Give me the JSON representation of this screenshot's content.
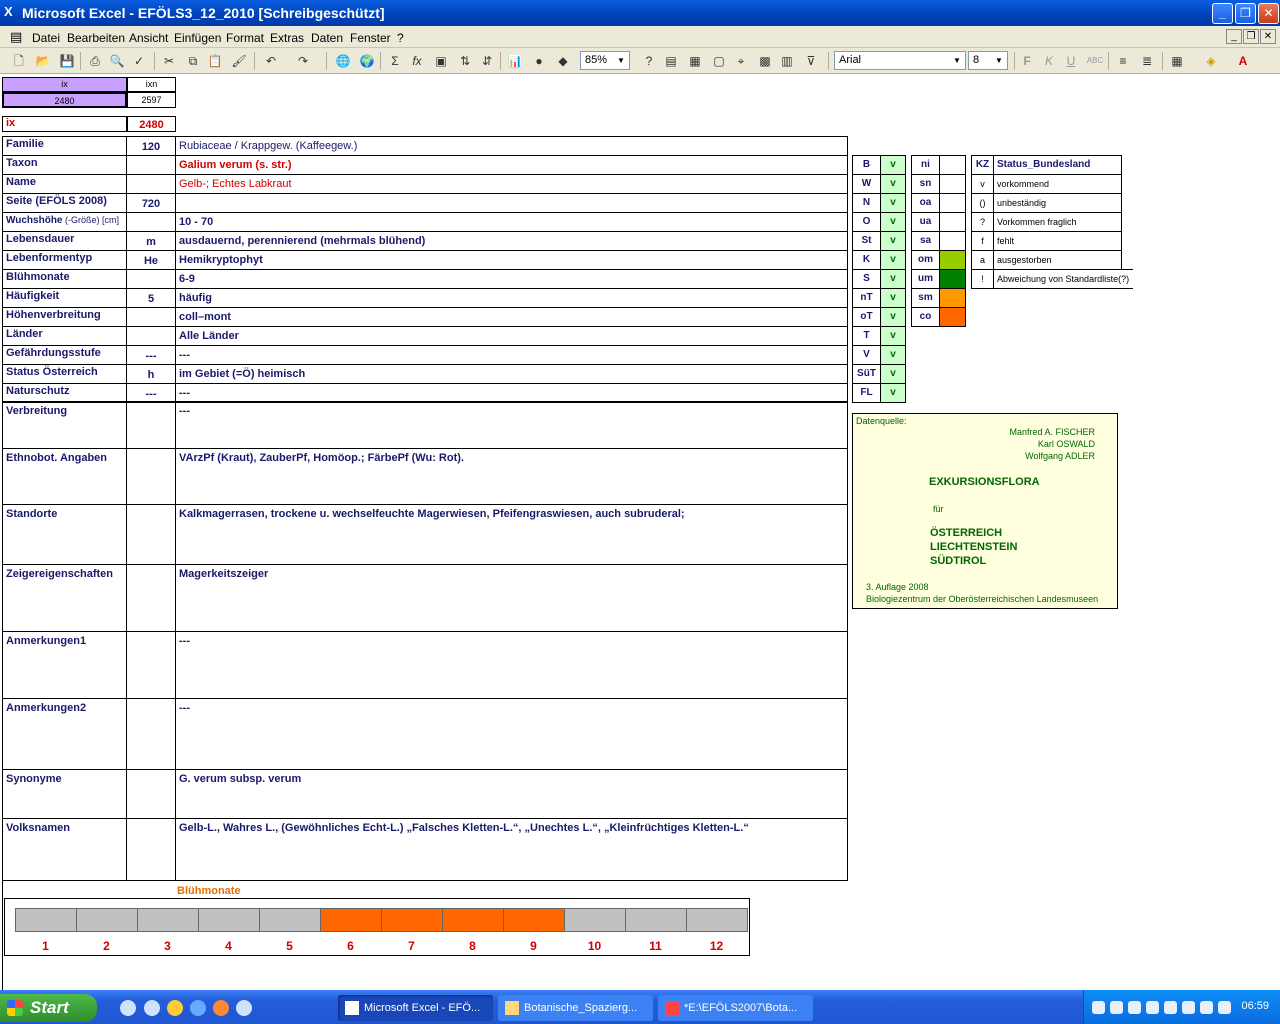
{
  "window": {
    "title": "Microsoft Excel - EFÖLS3_12_2010  [Schreibgeschützt]"
  },
  "menu": [
    "Datei",
    "Bearbeiten",
    "Ansicht",
    "Einfügen",
    "Format",
    "Extras",
    "Daten",
    "Fenster",
    "?"
  ],
  "toolbar": {
    "zoom": "85%",
    "font": "Arial",
    "size": "8"
  },
  "index": {
    "h1": "ix",
    "h2": "ixn",
    "v1": "2480",
    "v2": "2597",
    "ix_label": "ix",
    "ix_value": "2480"
  },
  "rows": [
    {
      "label": "Familie",
      "code": "120",
      "value": "Rubiaceae  /  Krappgew. (Kaffeegew.)"
    },
    {
      "label": "Taxon",
      "code": "",
      "value": "Galium verum (s. str.)"
    },
    {
      "label": "Name",
      "code": "",
      "value": "Gelb-; Echtes Labkraut"
    },
    {
      "label": "Seite (EFÖLS 2008)",
      "code": "720",
      "value": ""
    },
    {
      "label": "Wuchshöhe",
      "label_extra": " (-Größe) [cm]",
      "code": "",
      "value": " 10 - 70"
    },
    {
      "label": "Lebensdauer",
      "code": "m",
      "value": "ausdauernd, perennierend (mehrmals blühend)"
    },
    {
      "label": "Lebenformentyp",
      "code": "He",
      "value": "Hemikryptophyt"
    },
    {
      "label": "Blühmonate",
      "code": "",
      "value": " 6-9"
    },
    {
      "label": "Häufigkeit",
      "code": "5",
      "value": "häufig"
    },
    {
      "label": "Höhenverbreitung",
      "code": "",
      "value": "coll–mont"
    },
    {
      "label": "Länder",
      "code": "",
      "value": "Alle Länder"
    },
    {
      "label": "Gefährdungsstufe",
      "code": "---",
      "value": "  ---"
    },
    {
      "label": "Status Österreich",
      "code": "h",
      "value": "im Gebiet (=Ö) heimisch"
    },
    {
      "label": "Naturschutz",
      "code": "---",
      "value": " ---"
    }
  ],
  "big_rows": [
    {
      "label": "Verbreitung",
      "value": " ---"
    },
    {
      "label": "Ethnobot. Angaben",
      "value": "VArzPf (Kraut), ZauberPf, Homöop.; FärbePf (Wu: Rot)."
    },
    {
      "label": "Standorte",
      "value": "Kalkmagerrasen, trockene u. wechselfeuchte Magerwiesen, Pfeifengraswiesen, auch subruderal;"
    },
    {
      "label": "Zeigereigenschaften",
      "value": "Magerkeitszeiger"
    },
    {
      "label": "Anmerkungen1",
      "value": "---"
    },
    {
      "label": "Anmerkungen2",
      "value": "---"
    },
    {
      "label": "Synonyme",
      "value": "G. verum subsp. verum"
    },
    {
      "label": "Volksnamen",
      "value": "Gelb-L., Wahres L., (Gewöhnliches Echt-L.)  „Falsches Kletten-L.“, „Unechtes L.“, „Kleinfrüchtiges Kletten-L.“"
    }
  ],
  "states": [
    {
      "k": "B",
      "v": "v"
    },
    {
      "k": "W",
      "v": "v"
    },
    {
      "k": "N",
      "v": "v"
    },
    {
      "k": "O",
      "v": "v"
    },
    {
      "k": "St",
      "v": "v"
    },
    {
      "k": "K",
      "v": "v"
    },
    {
      "k": "S",
      "v": "v"
    },
    {
      "k": "nT",
      "v": "v"
    },
    {
      "k": "oT",
      "v": "v"
    },
    {
      "k": "T",
      "v": "v"
    },
    {
      "k": "V",
      "v": "v"
    },
    {
      "k": "SüT",
      "v": "v"
    },
    {
      "k": "FL",
      "v": "v"
    }
  ],
  "status2": [
    {
      "k": "ni",
      "color": ""
    },
    {
      "k": "sn",
      "color": ""
    },
    {
      "k": "oa",
      "color": ""
    },
    {
      "k": "ua",
      "color": ""
    },
    {
      "k": "sa",
      "color": ""
    },
    {
      "k": "om",
      "color": "#99cc00"
    },
    {
      "k": "um",
      "color": "#008000"
    },
    {
      "k": "sm",
      "color": "#ff9900"
    },
    {
      "k": "co",
      "color": "#ff6600"
    }
  ],
  "legend": [
    {
      "k": "KZ",
      "t": "Status_Bundesland"
    },
    {
      "k": "v",
      "t": "vorkommend"
    },
    {
      "k": "()",
      "t": "unbeständig"
    },
    {
      "k": "?",
      "t": "Vorkommen fraglich"
    },
    {
      "k": "f",
      "t": "fehlt"
    },
    {
      "k": "a",
      "t": "ausgestorben"
    },
    {
      "k": "!",
      "t": "Abweichung von Standardliste(?)"
    }
  ],
  "source": {
    "label": "Datenquelle:",
    "authors": [
      "Manfred A. FISCHER",
      "Karl OSWALD",
      "Wolfgang ADLER"
    ],
    "title": "EXKURSIONSFLORA",
    "fuer": "für",
    "countries": [
      "ÖSTERREICH",
      "LIECHTENSTEIN",
      "SÜDTIROL"
    ],
    "edition": "3. Auflage 2008",
    "publisher": "Biologiezentrum der Oberösterreichischen Landesmuseen"
  },
  "bloom": {
    "title": "Blühmonate",
    "months": [
      "1",
      "2",
      "3",
      "4",
      "5",
      "6",
      "7",
      "8",
      "9",
      "10",
      "11",
      "12"
    ],
    "active": [
      false,
      false,
      false,
      false,
      false,
      true,
      true,
      true,
      true,
      false,
      false,
      false
    ],
    "active_color": "#ff6600",
    "inactive_color": "#c0c0c0"
  },
  "taskbar": {
    "start": "Start",
    "tasks": [
      "Microsoft Excel - EFÖ...",
      "Botanische_Spazierg...",
      "*E:\\EFÖLS2007\\Bota..."
    ],
    "clock": "06:59"
  }
}
